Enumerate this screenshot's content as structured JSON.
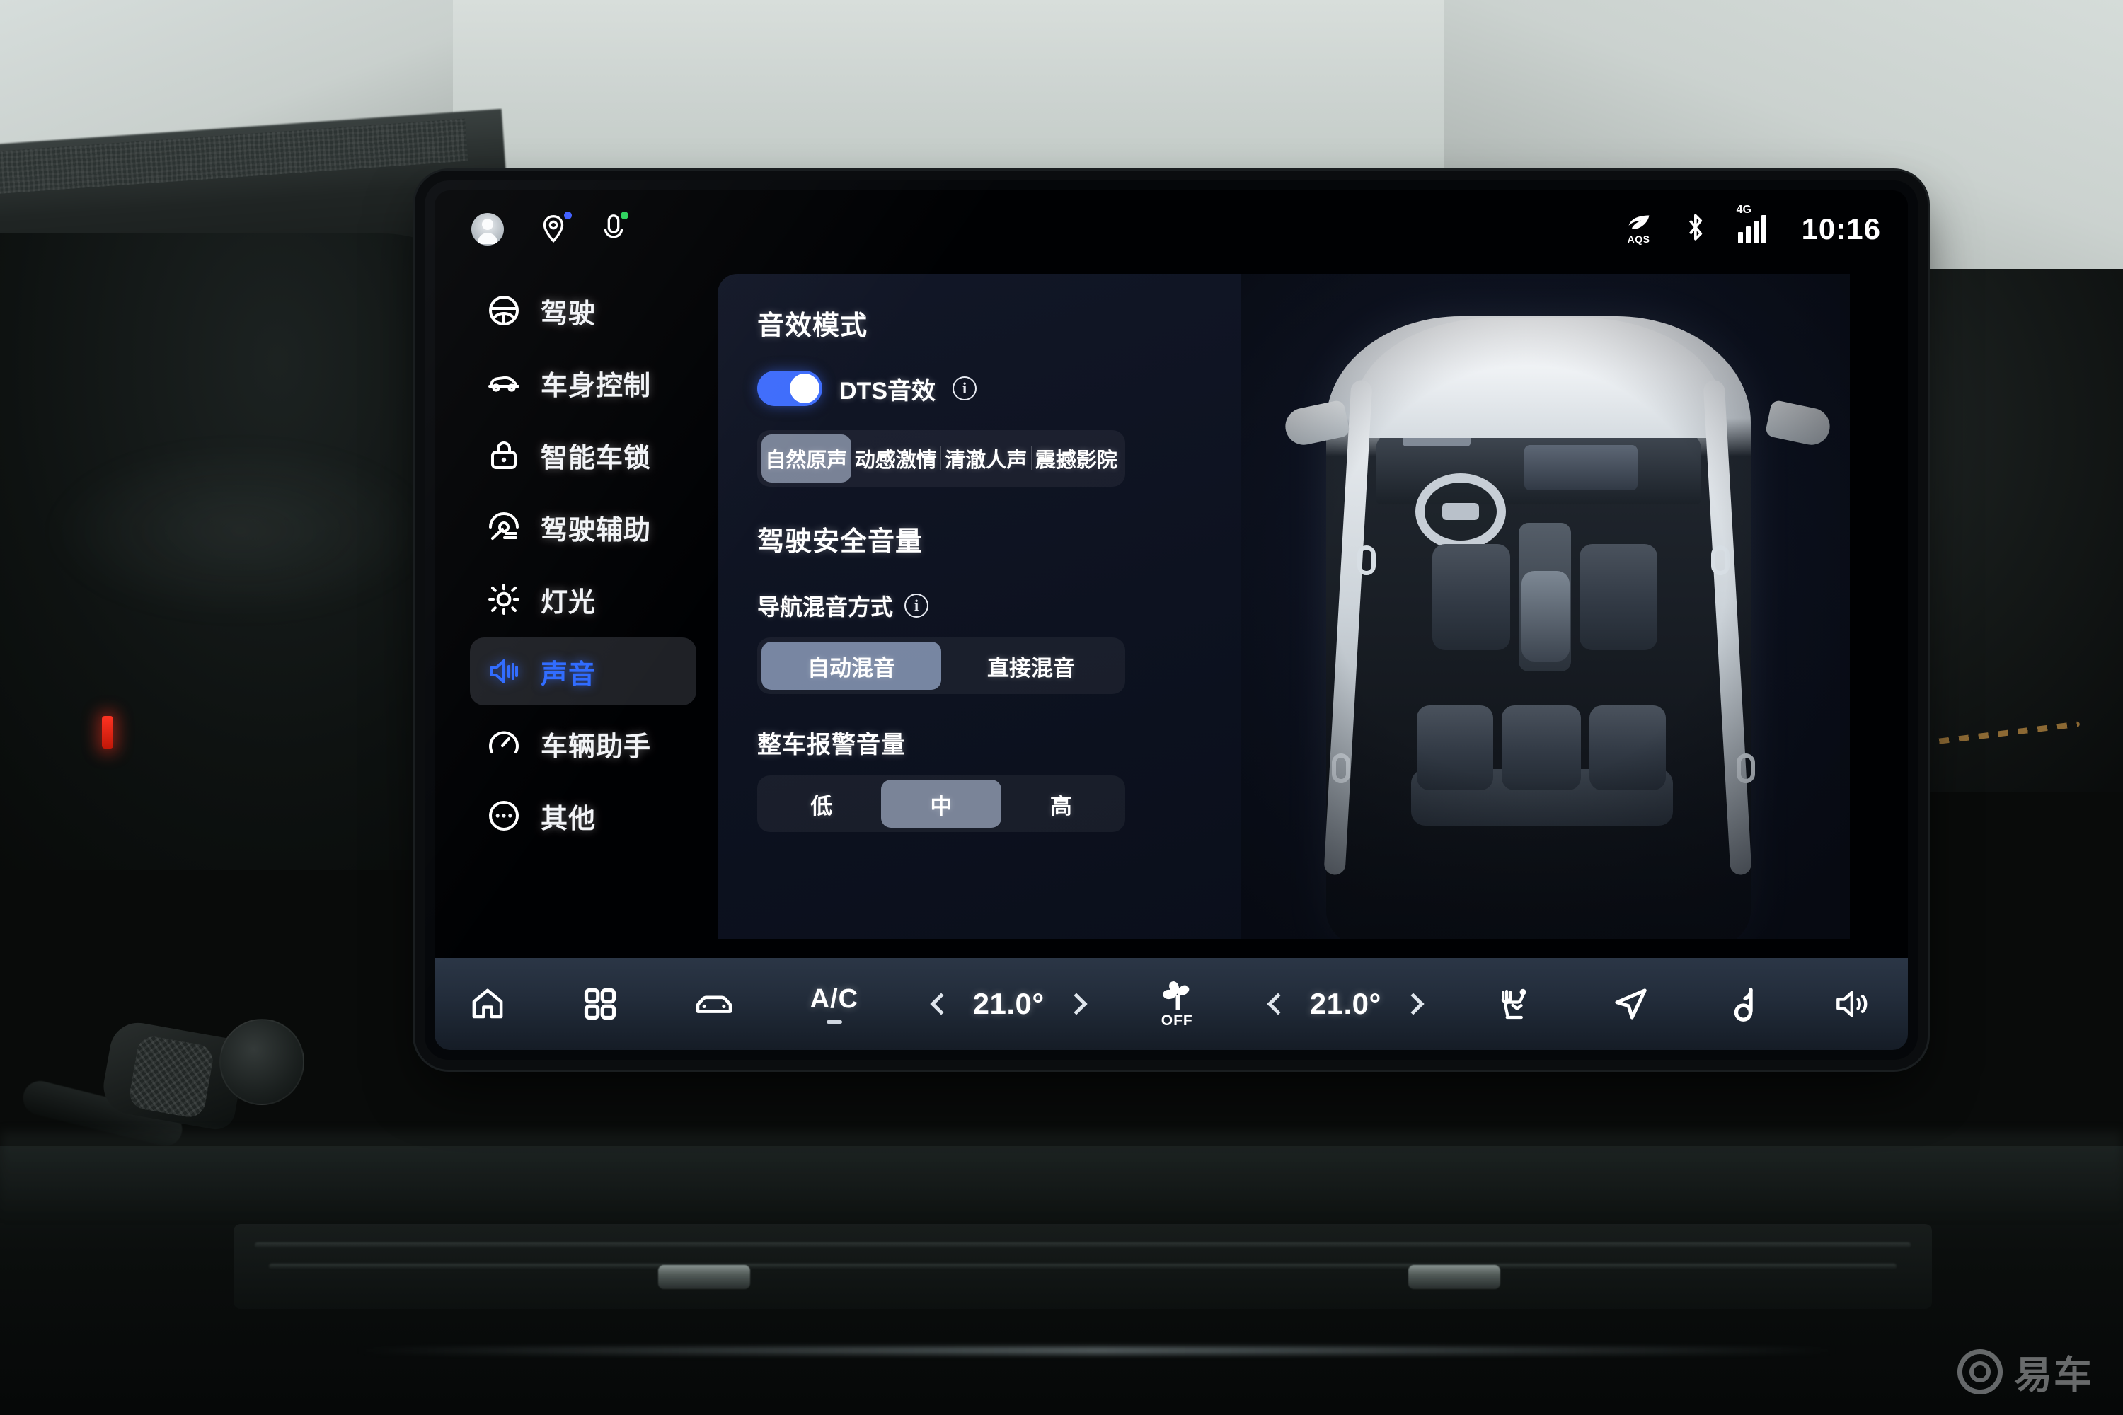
{
  "status_bar": {
    "left_icons": [
      {
        "name": "avatar",
        "label": "user-profile"
      },
      {
        "name": "location-pin-icon",
        "label": "location",
        "badge_color": "#3b5bff"
      },
      {
        "name": "microphone-icon",
        "label": "voice-assistant",
        "badge_color": "#2ad15a"
      }
    ],
    "right": {
      "aqs_label": "AQS",
      "bluetooth": "bluetooth-icon",
      "network_type": "4G",
      "signal_bars": 4,
      "time": "10:16"
    }
  },
  "sidebar": {
    "items": [
      {
        "label": "驾驶",
        "icon": "steering-wheel-icon",
        "selected": false
      },
      {
        "label": "车身控制",
        "icon": "car-side-icon",
        "selected": false
      },
      {
        "label": "智能车锁",
        "icon": "lock-icon",
        "selected": false
      },
      {
        "label": "驾驶辅助",
        "icon": "adas-icon",
        "selected": false
      },
      {
        "label": "灯光",
        "icon": "light-sun-icon",
        "selected": false
      },
      {
        "label": "声音",
        "icon": "speaker-icon",
        "selected": true
      },
      {
        "label": "车辆助手",
        "icon": "gauge-icon",
        "selected": false
      },
      {
        "label": "其他",
        "icon": "ellipsis-circle-icon",
        "selected": false
      }
    ],
    "active_color": "#2f6bff"
  },
  "panel": {
    "sound_mode": {
      "title": "音效模式",
      "dts_toggle": {
        "label": "DTS音效",
        "on": true,
        "info": "i"
      },
      "modes": [
        "自然原声",
        "动感激情",
        "清澈人声",
        "震撼影院"
      ],
      "selected_mode": "自然原声"
    },
    "safety_volume": {
      "title": "驾驶安全音量",
      "nav_mix": {
        "label": "导航混音方式",
        "info": "i",
        "options": [
          "自动混音",
          "直接混音"
        ],
        "selected": "自动混音"
      }
    },
    "alarm_volume": {
      "title": "整车报警音量",
      "options": [
        "低",
        "中",
        "高"
      ],
      "selected": "中"
    },
    "car_render": {
      "name": "vehicle-top-down-render"
    }
  },
  "dock": {
    "home": "home-icon",
    "apps": "apps-grid-icon",
    "car": "car-front-icon",
    "ac_label": "A/C",
    "temp_left": "21.0°",
    "temp_right": "21.0°",
    "fan_label": "OFF",
    "fan_icon": "fan-icon",
    "seat_airflow": "seat-airflow-icon",
    "navigation": "navigation-arrow-icon",
    "music": "music-note-icon",
    "volume": "volume-icon",
    "chev_left": "chevron-left-icon",
    "chev_right": "chevron-right-icon"
  },
  "watermark": {
    "text": "易车"
  }
}
